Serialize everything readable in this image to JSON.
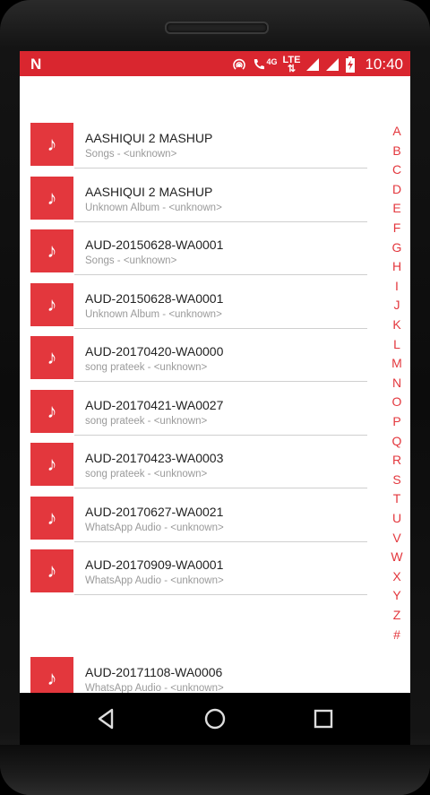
{
  "status_bar": {
    "app_icon": "N",
    "network": "4G",
    "lte": "LTE",
    "time": "10:40",
    "icons": [
      "hotspot-icon",
      "wifi-calling-icon",
      "signal-icon",
      "signal-icon",
      "battery-charging-icon"
    ],
    "color": "#d9262f"
  },
  "songs": [
    {
      "title": "AASHIQUI 2 MASHUP",
      "subtitle": "Songs - <unknown>"
    },
    {
      "title": "AASHIQUI 2 MASHUP",
      "subtitle": "Unknown Album - <unknown>"
    },
    {
      "title": "AUD-20150628-WA0001",
      "subtitle": "Songs - <unknown>"
    },
    {
      "title": "AUD-20150628-WA0001",
      "subtitle": "Unknown Album - <unknown>"
    },
    {
      "title": "AUD-20170420-WA0000",
      "subtitle": "song prateek - <unknown>"
    },
    {
      "title": "AUD-20170421-WA0027",
      "subtitle": "song prateek - <unknown>"
    },
    {
      "title": "AUD-20170423-WA0003",
      "subtitle": "song prateek - <unknown>"
    },
    {
      "title": "AUD-20170627-WA0021",
      "subtitle": "WhatsApp Audio - <unknown>"
    },
    {
      "title": "AUD-20170909-WA0001",
      "subtitle": "WhatsApp Audio - <unknown>"
    },
    {
      "title": "AUD-20171108-WA0006",
      "subtitle": "WhatsApp Audio - <unknown>"
    }
  ],
  "music_note": "♪",
  "alphabet": [
    "A",
    "B",
    "C",
    "D",
    "E",
    "F",
    "G",
    "H",
    "I",
    "J",
    "K",
    "L",
    "M",
    "N",
    "O",
    "P",
    "Q",
    "R",
    "S",
    "T",
    "U",
    "V",
    "W",
    "X",
    "Y",
    "Z",
    "#"
  ],
  "accent_color": "#e3373d",
  "nav": [
    "back-icon",
    "home-icon",
    "recents-icon"
  ]
}
